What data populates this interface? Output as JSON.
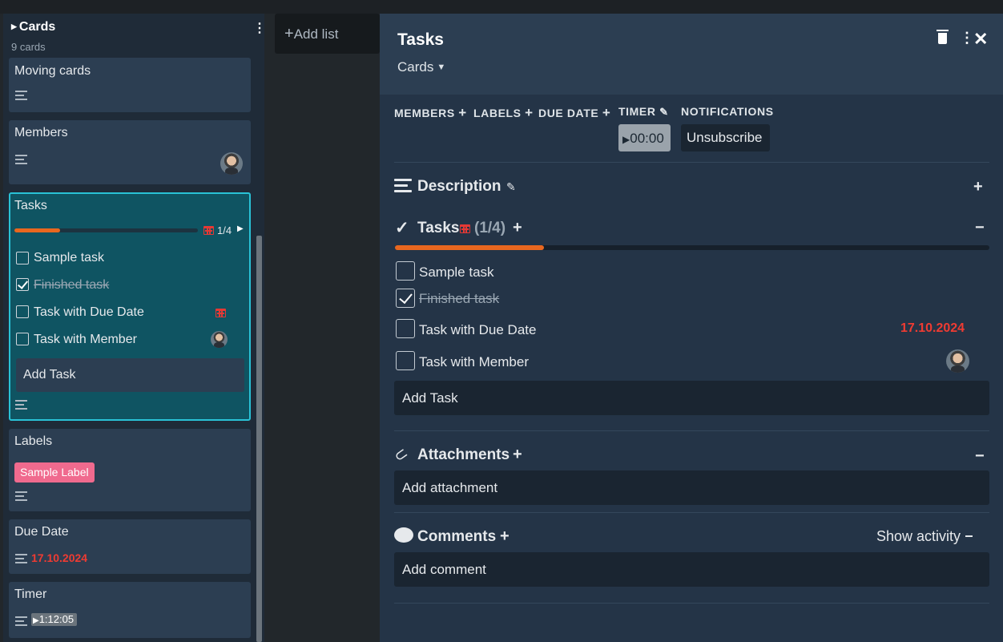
{
  "board": {
    "add_list_label": "Add list"
  },
  "list": {
    "title": "Cards",
    "count": "9 cards",
    "cards": {
      "moving": {
        "title": "Moving cards"
      },
      "members": {
        "title": "Members"
      },
      "tasks": {
        "title": "Tasks",
        "progress_label": "1/4",
        "progress_fraction": 0.25,
        "items": [
          {
            "label": "Sample task",
            "checked": false
          },
          {
            "label": "Finished task",
            "checked": true
          },
          {
            "label": "Task with Due Date",
            "checked": false
          },
          {
            "label": "Task with Member",
            "checked": false
          }
        ],
        "add_task_label": "Add Task"
      },
      "labels": {
        "title": "Labels",
        "label_chip": "Sample Label",
        "label_color": "#f06a8e"
      },
      "due": {
        "title": "Due Date",
        "date": "17.10.2024"
      },
      "timer": {
        "title": "Timer",
        "value": "1:12:05"
      }
    }
  },
  "panel": {
    "title": "Tasks",
    "list_name": "Cards",
    "meta": {
      "members": "MEMBERS",
      "labels": "LABELS",
      "due_date": "DUE DATE",
      "timer": "TIMER",
      "notifications": "NOTIFICATIONS",
      "timer_value": "00:00",
      "unsubscribe": "Unsubscribe"
    },
    "description": {
      "title": "Description"
    },
    "tasks": {
      "title": "Tasks",
      "count": "(1/4)",
      "progress_fraction": 0.25,
      "items": [
        {
          "label": "Sample task",
          "checked": false
        },
        {
          "label": "Finished task",
          "checked": true
        },
        {
          "label": "Task with Due Date",
          "checked": false,
          "due": "17.10.2024"
        },
        {
          "label": "Task with Member",
          "checked": false
        }
      ],
      "add_task_label": "Add Task"
    },
    "attachments": {
      "title": "Attachments",
      "add_label": "Add attachment"
    },
    "comments": {
      "title": "Comments",
      "show_activity": "Show activity",
      "add_label": "Add comment"
    }
  },
  "colors": {
    "accent": "#29c2d6",
    "progress": "#e8671f",
    "due": "#ef3b32"
  }
}
